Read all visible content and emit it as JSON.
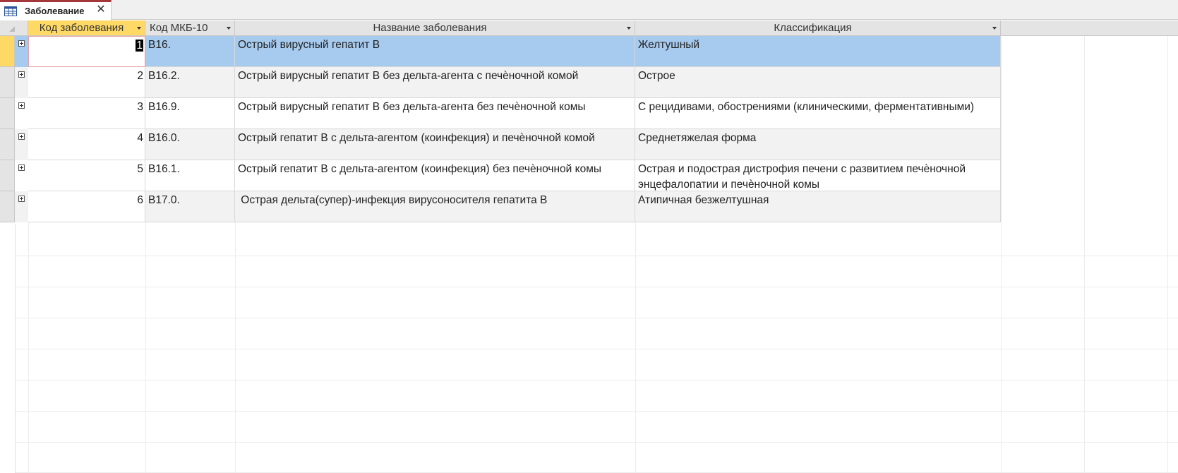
{
  "tab": {
    "title": "Заболевание",
    "close_glyph": "✕",
    "icon": "table-icon"
  },
  "columns": {
    "col1": "Код заболевания",
    "col2": "Код МКБ-10",
    "col3": "Название заболевания",
    "col4": "Классификация"
  },
  "rows": [
    {
      "id": "1",
      "mkb": "B16.",
      "name": "Острый вирусный гепатит B",
      "class": "Желтушный"
    },
    {
      "id": "2",
      "mkb": "B16.2.",
      "name": "Острый вирусный гепатит B без дельта-агента с печѐночной комой",
      "class": "Острое"
    },
    {
      "id": "3",
      "mkb": "B16.9.",
      "name": "Острый вирусный гепатит B без дельта-агента без печѐночной комы",
      "class": "С рецидивами, обострениями (клиническими, ферментативными)"
    },
    {
      "id": "4",
      "mkb": "B16.0.",
      "name": "Острый гепатит B с дельта-агентом (коинфекция) и печѐночной комой",
      "class": "Среднетяжелая форма"
    },
    {
      "id": "5",
      "mkb": "B16.1.",
      "name": "Острый гепатит B с дельта-агентом (коинфекция) без печѐночной комы",
      "class": "Острая и подострая дистрофия печени с развитием печѐночной энцефалопатии и печѐночной комы"
    },
    {
      "id": "6",
      "mkb": "B17.0.",
      "name": " Острая дельта(супер)-инфекция вирусоносителя гепатита B",
      "class": "Атипичная безжелтушная"
    }
  ],
  "colors": {
    "selected_row": "#a7cbef",
    "selected_header": "#ffd966",
    "tab_accent": "#a4373a"
  }
}
